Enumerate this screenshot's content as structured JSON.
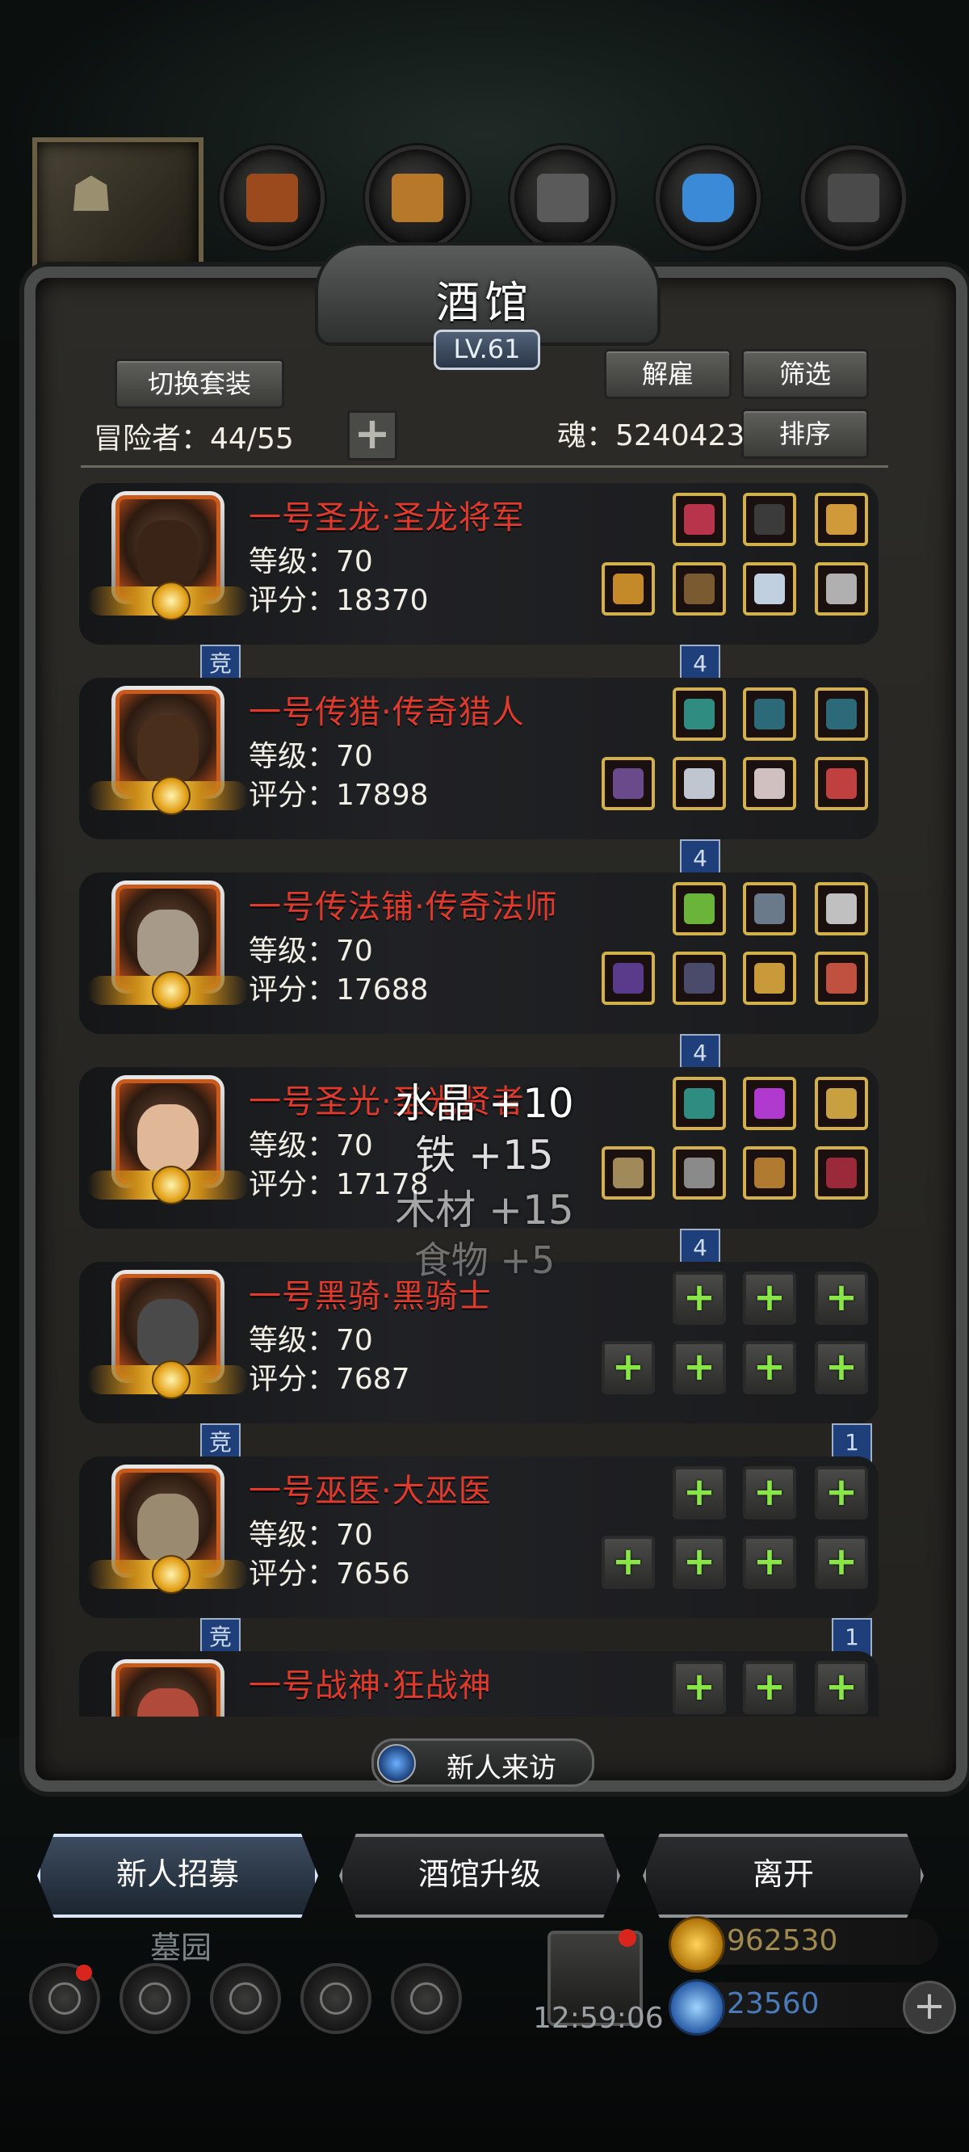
{
  "window": {
    "title": "酒馆",
    "level": "LV.61"
  },
  "buttons": {
    "switch_outfit": "切换套装",
    "dismiss": "解雇",
    "filter": "筛选",
    "sort": "排序"
  },
  "roster": {
    "adventurers_label": "冒险者：44/55",
    "soul_label": "魂：5240423",
    "add_symbol": "+"
  },
  "heroes": [
    {
      "name": "一号圣龙·圣龙将军",
      "level": "等级：70",
      "score": "评分：18370",
      "left_tag": "竞",
      "right_tag": "4",
      "face_color": "#3a2418",
      "equipped": true,
      "gear_colors": [
        "#b8344a",
        "#3b3b3b",
        "#d09a3a",
        "#c48a2a",
        "#7a5a30",
        "#c0d0e0",
        "#b0b0b0",
        "#7aa89c"
      ]
    },
    {
      "name": "一号传猎·传奇猎人",
      "level": "等级：70",
      "score": "评分：17898",
      "left_tag": "",
      "right_tag": "4",
      "face_color": "#4a2e1c",
      "equipped": true,
      "gear_colors": [
        "#2e8c80",
        "#2c6a7a",
        "#2c6a7a",
        "#6a4a8a",
        "#c0c6d0",
        "#d0c0c0",
        "#c04040",
        "#c0b080"
      ]
    },
    {
      "name": "一号传法铺·传奇法师",
      "level": "等级：70",
      "score": "评分：17688",
      "left_tag": "",
      "right_tag": "4",
      "face_color": "#a89a88",
      "equipped": true,
      "gear_colors": [
        "#6ab43a",
        "#6a7a8a",
        "#c0c0c0",
        "#5a3a8a",
        "#4a4a6a",
        "#c89a3a",
        "#c05040",
        "#7a4a2a"
      ]
    },
    {
      "name": "一号圣光·圣光贤者",
      "level": "等级：70",
      "score": "评分：17178",
      "left_tag": "",
      "right_tag": "4",
      "face_color": "#e0b898",
      "equipped": true,
      "gear_colors": [
        "#2e8c80",
        "#b03ad0",
        "#c8a040",
        "#a08a5a",
        "#8a8a8a",
        "#b07a30",
        "#9a2a3a",
        "#7a4a2a"
      ]
    },
    {
      "name": "一号黑骑·黑骑士",
      "level": "等级：70",
      "score": "评分：7687",
      "left_tag": "竞",
      "right_tag": "1",
      "face_color": "#4a4a4a",
      "equipped": false
    },
    {
      "name": "一号巫医·大巫医",
      "level": "等级：70",
      "score": "评分：7656",
      "left_tag": "竞",
      "right_tag": "1",
      "face_color": "#9a8a70",
      "equipped": false
    },
    {
      "name": "一号战神·狂战神",
      "level": "",
      "score": "",
      "left_tag": "",
      "right_tag": "",
      "face_color": "#b04a3a",
      "equipped": false
    }
  ],
  "float_texts": [
    "水晶 +10",
    "铁 +15",
    "木材 +15",
    "食物 +5"
  ],
  "visitor_bar": {
    "label": "新人来访"
  },
  "bottom_buttons": {
    "recruit": "新人招募",
    "upgrade": "酒馆升级",
    "leave": "离开"
  },
  "dock": {
    "graveyard_label": "墓园",
    "timer": "12:59:06"
  },
  "currencies": {
    "gold": "962530",
    "gems": "23560"
  }
}
